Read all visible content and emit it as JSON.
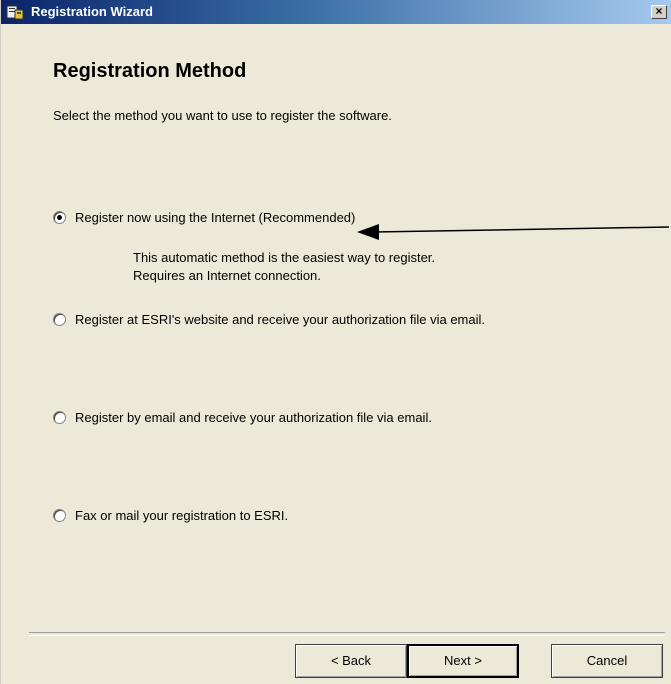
{
  "window": {
    "title": "Registration Wizard",
    "close_glyph": "×",
    "icon": "registration-wizard-icon"
  },
  "page": {
    "heading": "Registration Method",
    "instruction": "Select the method you want to use to register the software."
  },
  "options": [
    {
      "label": "Register now using the Internet (Recommended)",
      "selected": true
    },
    {
      "label": "Register at ESRI's website and receive your authorization file via email.",
      "selected": false
    },
    {
      "label": "Register by email and receive your authorization file via email.",
      "selected": false
    },
    {
      "label": "Fax or mail your registration to ESRI.",
      "selected": false
    }
  ],
  "option_description": {
    "line1": "This automatic method is the easiest way to register.",
    "line2": "Requires an Internet connection."
  },
  "buttons": {
    "back": "< Back",
    "next": "Next >",
    "cancel": "Cancel"
  },
  "colors": {
    "title_bar_start": "#0a246a",
    "title_bar_end": "#a6caf0",
    "dialog_background": "#ece9d8"
  }
}
